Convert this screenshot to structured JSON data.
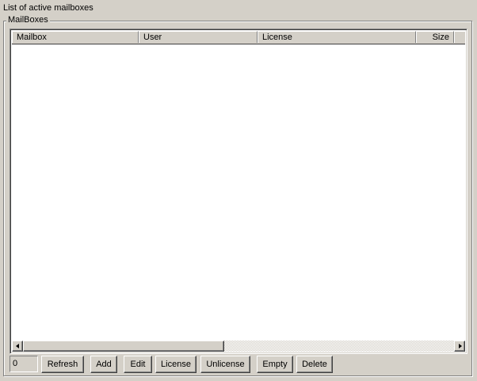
{
  "page": {
    "heading": "List of active mailboxes"
  },
  "group": {
    "label": "MailBoxes"
  },
  "table": {
    "columns": [
      "Mailbox",
      "User",
      "License",
      "Size"
    ],
    "rows": []
  },
  "footer": {
    "count_value": "0",
    "buttons": {
      "refresh": "Refresh",
      "add": "Add",
      "edit": "Edit",
      "license": "License",
      "unlicense": "Unlicense",
      "empty": "Empty",
      "delete": "Delete"
    }
  },
  "icons": {
    "scroll_left": "arrow-left-icon",
    "scroll_right": "arrow-right-icon"
  },
  "colors": {
    "window_bg": "#d4d0c8",
    "list_bg": "#ffffff"
  }
}
